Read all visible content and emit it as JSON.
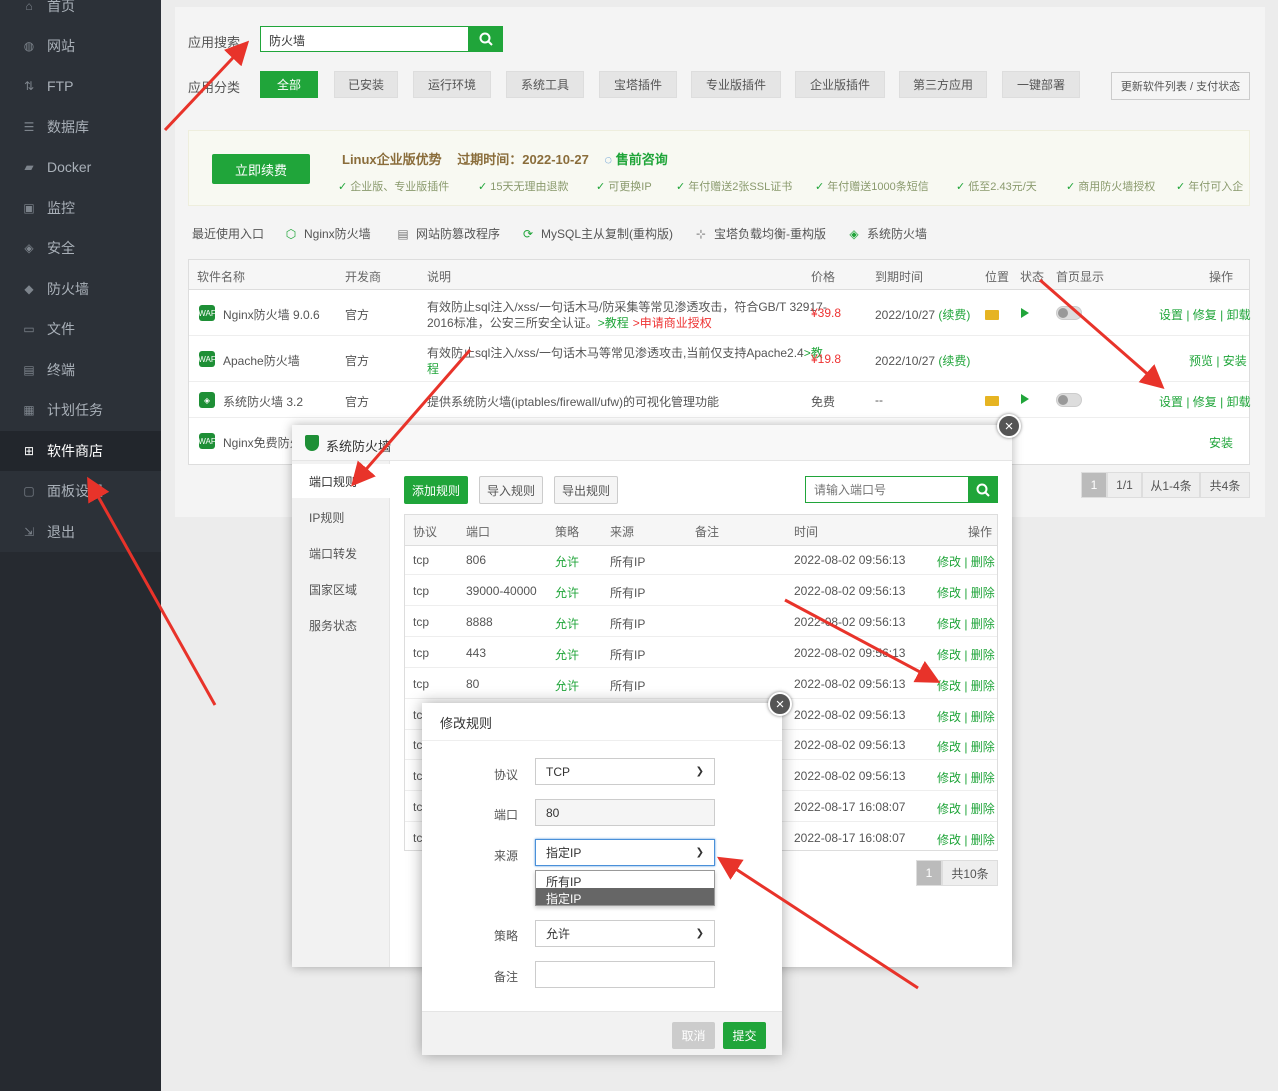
{
  "sidebar": {
    "items": [
      {
        "label": "首页",
        "icon": "home-icon"
      },
      {
        "label": "网站",
        "icon": "globe-icon"
      },
      {
        "label": "FTP",
        "icon": "ftp-icon"
      },
      {
        "label": "数据库",
        "icon": "database-icon"
      },
      {
        "label": "Docker",
        "icon": "docker-icon"
      },
      {
        "label": "监控",
        "icon": "monitor-icon"
      },
      {
        "label": "安全",
        "icon": "shield-icon"
      },
      {
        "label": "防火墙",
        "icon": "firewall-icon"
      },
      {
        "label": "文件",
        "icon": "folder-icon"
      },
      {
        "label": "终端",
        "icon": "terminal-icon"
      },
      {
        "label": "计划任务",
        "icon": "calendar-icon"
      },
      {
        "label": "软件商店",
        "icon": "grid-icon"
      },
      {
        "label": "面板设置",
        "icon": "settings-icon"
      },
      {
        "label": "退出",
        "icon": "logout-icon"
      }
    ],
    "active_index": 11
  },
  "search": {
    "label": "应用搜索",
    "value": "防火墙"
  },
  "categories": {
    "label": "应用分类",
    "items": [
      "全部",
      "已安装",
      "运行环境",
      "系统工具",
      "宝塔插件",
      "专业版插件",
      "企业版插件",
      "第三方应用",
      "一键部署"
    ],
    "active_index": 0
  },
  "update_button": "更新软件列表 / 支付状态",
  "promo": {
    "renew_button": "立即续费",
    "title": "Linux企业版优势",
    "expiry_label": "过期时间：2022-10-27",
    "consult": "售前咨询",
    "features": [
      "企业版、专业版插件",
      "15天无理由退款",
      "可更换IP",
      "年付赠送2张SSL证书",
      "年付赠送1000条短信",
      "低至2.43元/天",
      "商用防火墙授权",
      "年付可入企"
    ]
  },
  "recent": {
    "label": "最近使用入口",
    "items": [
      "Nginx防火墙",
      "网站防篡改程序",
      "MySQL主从复制(重构版)",
      "宝塔负载均衡-重构版",
      "系统防火墙"
    ]
  },
  "software_table": {
    "headers": [
      "软件名称",
      "开发商",
      "说明",
      "价格",
      "到期时间",
      "位置",
      "状态",
      "首页显示",
      "操作"
    ],
    "rows": [
      {
        "name": "Nginx防火墙 9.0.6",
        "vendor": "官方",
        "desc1": "有效防止sql注入/xss/一句话木马/防采集等常见渗透攻击，符合GB/T 32917-",
        "desc2": "2016标准，公安三所安全认证。",
        "link1": ">教程",
        "link2": ">申请商业授权",
        "price": "¥39.8",
        "expiry": "2022/10/27",
        "renew": "(续费)",
        "ops": "设置 | 修复 | 卸载"
      },
      {
        "name": "Apache防火墙",
        "vendor": "官方",
        "desc1": "有效防止sql注入/xss/一句话木马等常见渗透攻击,当前仅支持Apache2.4",
        "link1": ">教",
        "link1b": "程",
        "price": "¥19.8",
        "expiry": "2022/10/27",
        "renew": "(续费)",
        "ops": "预览 | 安装"
      },
      {
        "name": "系统防火墙 3.2",
        "vendor": "官方",
        "desc1": "提供系统防火墙(iptables/firewall/ufw)的可视化管理功能",
        "price": "免费",
        "expiry": "--",
        "ops": "设置 | 修复 | 卸载"
      },
      {
        "name": "Nginx免费防火",
        "ops": "安装"
      }
    ]
  },
  "pagination": {
    "page": "1",
    "total_pages": "1/1",
    "range": "从1-4条",
    "total": "共4条"
  },
  "firewall_dialog": {
    "title": "系统防火墙",
    "tabs": [
      "端口规则",
      "IP规则",
      "端口转发",
      "国家区域",
      "服务状态"
    ],
    "buttons": {
      "add": "添加规则",
      "import": "导入规则",
      "export": "导出规则"
    },
    "search_placeholder": "请输入端口号",
    "headers": [
      "协议",
      "端口",
      "策略",
      "来源",
      "备注",
      "时间",
      "操作"
    ],
    "rows": [
      {
        "proto": "tcp",
        "port": "806",
        "policy": "允许",
        "source": "所有IP",
        "time": "2022-08-02 09:56:13",
        "ops": "修改 | 删除"
      },
      {
        "proto": "tcp",
        "port": "39000-40000",
        "policy": "允许",
        "source": "所有IP",
        "time": "2022-08-02 09:56:13",
        "ops": "修改 | 删除"
      },
      {
        "proto": "tcp",
        "port": "8888",
        "policy": "允许",
        "source": "所有IP",
        "time": "2022-08-02 09:56:13",
        "ops": "修改 | 删除"
      },
      {
        "proto": "tcp",
        "port": "443",
        "policy": "允许",
        "source": "所有IP",
        "time": "2022-08-02 09:56:13",
        "ops": "修改 | 删除"
      },
      {
        "proto": "tcp",
        "port": "80",
        "policy": "允许",
        "source": "所有IP",
        "time": "2022-08-02 09:56:13",
        "ops": "修改 | 删除"
      },
      {
        "proto": "tc",
        "time": "2022-08-02 09:56:13",
        "ops": "修改 | 删除"
      },
      {
        "proto": "tc",
        "time": "2022-08-02 09:56:13",
        "ops": "修改 | 删除"
      },
      {
        "proto": "tc",
        "time": "2022-08-02 09:56:13",
        "ops": "修改 | 删除"
      },
      {
        "proto": "tc",
        "time": "2022-08-17 16:08:07",
        "ops": "修改 | 删除"
      },
      {
        "proto": "tc",
        "time": "2022-08-17 16:08:07",
        "ops": "修改 | 删除"
      }
    ],
    "pagination": {
      "page": "1",
      "total": "共10条"
    }
  },
  "edit_dialog": {
    "title": "修改规则",
    "protocol": {
      "label": "协议",
      "value": "TCP"
    },
    "port": {
      "label": "端口",
      "value": "80"
    },
    "source": {
      "label": "来源",
      "value": "指定IP",
      "options": [
        "所有IP",
        "指定IP"
      ]
    },
    "policy": {
      "label": "策略",
      "value": "允许"
    },
    "note": {
      "label": "备注",
      "value": ""
    },
    "cancel": "取消",
    "submit": "提交"
  },
  "colors": {
    "accent": "#20a53a",
    "sidebar_bg": "#2c3138",
    "danger": "#ee3333",
    "arrow": "#e8332a"
  }
}
